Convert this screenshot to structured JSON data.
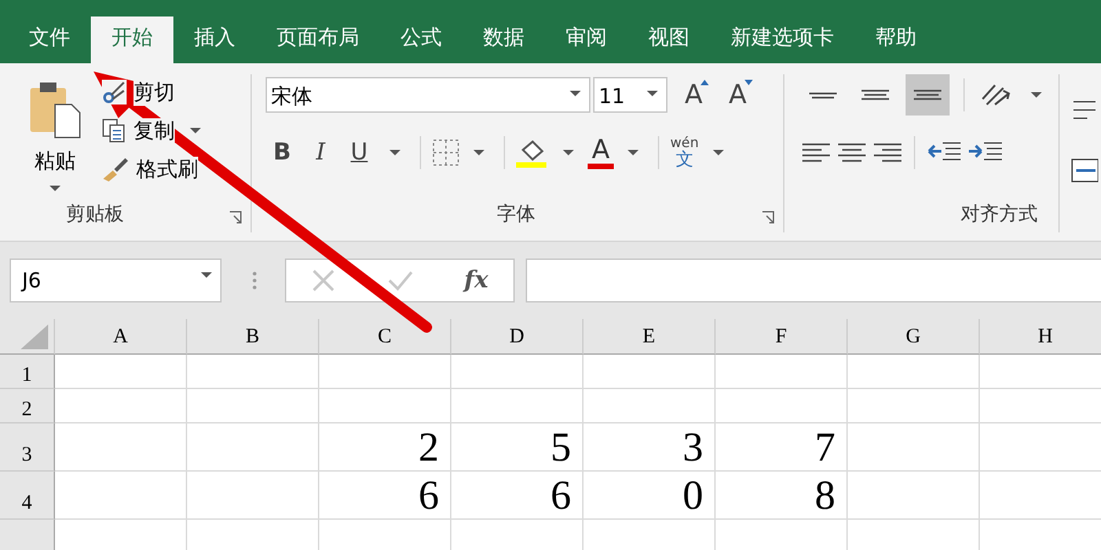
{
  "tabs": [
    {
      "label": "文件",
      "selected": false
    },
    {
      "label": "开始",
      "selected": true
    },
    {
      "label": "插入",
      "selected": false
    },
    {
      "label": "页面布局",
      "selected": false
    },
    {
      "label": "公式",
      "selected": false
    },
    {
      "label": "数据",
      "selected": false
    },
    {
      "label": "审阅",
      "selected": false
    },
    {
      "label": "视图",
      "selected": false
    },
    {
      "label": "新建选项卡",
      "selected": false
    },
    {
      "label": "帮助",
      "selected": false
    }
  ],
  "clipboard": {
    "paste": "粘贴",
    "cut": "剪切",
    "copy": "复制",
    "format_painter": "格式刷",
    "title": "剪贴板"
  },
  "font": {
    "name": "宋体",
    "size": "11",
    "grow": "A",
    "shrink": "A",
    "bold": "B",
    "italic": "I",
    "underline": "U",
    "font_color": "A",
    "phonetic_top": "wén",
    "phonetic_bottom": "文",
    "title": "字体"
  },
  "alignment": {
    "vertical": [
      {
        "selected": false
      },
      {
        "selected": false
      },
      {
        "selected": true
      }
    ],
    "title": "对齐方式"
  },
  "formula_bar": {
    "name_box": "J6",
    "function_label": "fx"
  },
  "sheet": {
    "columns": [
      "A",
      "B",
      "C",
      "D",
      "E",
      "F",
      "G",
      "H"
    ],
    "rows": [
      {
        "header": "1",
        "tall": false,
        "values": []
      },
      {
        "header": "2",
        "tall": false,
        "values": []
      },
      {
        "header": "3",
        "tall": true,
        "values": [
          "2",
          "5",
          "3",
          "7"
        ]
      },
      {
        "header": "4",
        "tall": true,
        "values": [
          "6",
          "6",
          "0",
          "8"
        ]
      }
    ]
  }
}
